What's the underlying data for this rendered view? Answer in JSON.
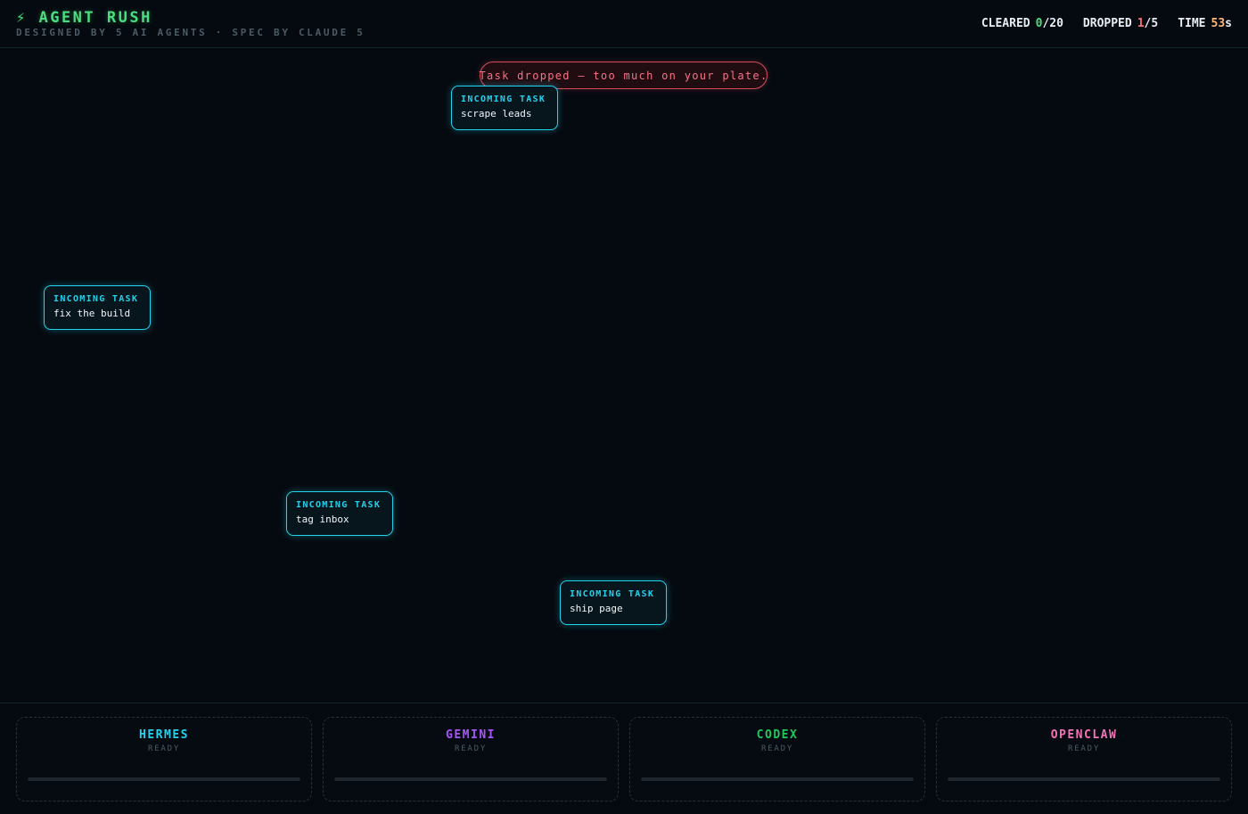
{
  "header": {
    "title": "⚡ AGENT RUSH",
    "subtitle": "DESIGNED BY 5 AI AGENTS · SPEC BY CLAUDE 5",
    "stats": {
      "cleared_label": "CLEARED",
      "cleared_value": "0",
      "cleared_total": "/20",
      "dropped_label": "DROPPED",
      "dropped_value": "1",
      "dropped_total": "/5",
      "time_label": "TIME",
      "time_value": "53",
      "time_unit": "s"
    }
  },
  "toast": {
    "message": "Task dropped — too much on your plate."
  },
  "tasks": [
    {
      "label": "INCOMING TASK",
      "name": "scrape leads"
    },
    {
      "label": "INCOMING TASK",
      "name": "fix the build"
    },
    {
      "label": "INCOMING TASK",
      "name": "tag inbox"
    },
    {
      "label": "INCOMING TASK",
      "name": "ship page"
    }
  ],
  "agents": [
    {
      "name": "HERMES",
      "status": "READY",
      "color": "#22d3ee",
      "progress": 0
    },
    {
      "name": "GEMINI",
      "status": "READY",
      "color": "#a855f7",
      "progress": 0
    },
    {
      "name": "CODEX",
      "status": "READY",
      "color": "#22c55e",
      "progress": 0
    },
    {
      "name": "OPENCLAW",
      "status": "READY",
      "color": "#f472b6",
      "progress": 0
    }
  ],
  "colors": {
    "accent": "#4ade80",
    "task_border": "#22d3ee",
    "toast_border": "#d94a5c"
  }
}
